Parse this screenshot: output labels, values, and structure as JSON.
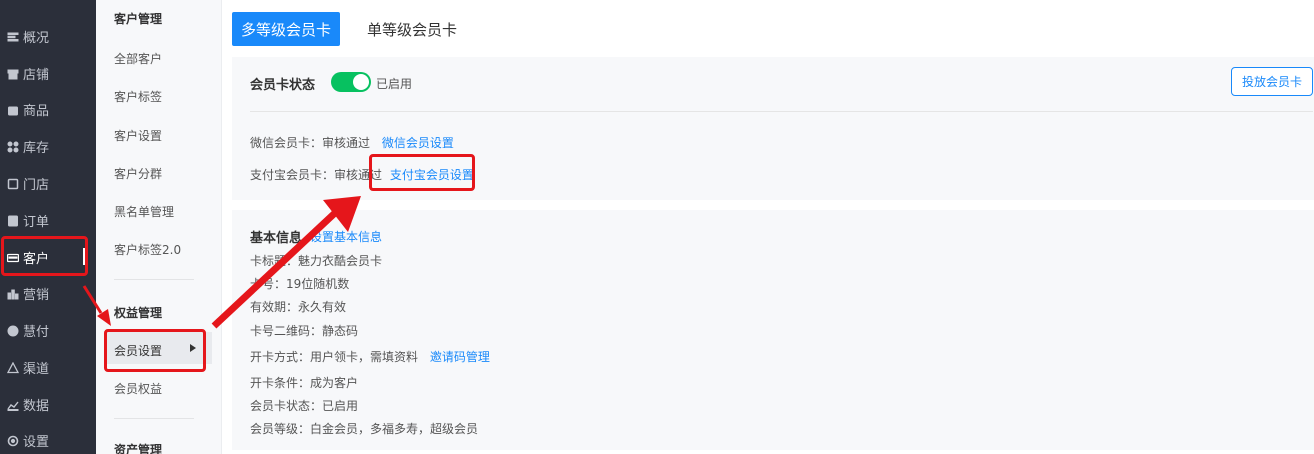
{
  "nav": {
    "items": [
      {
        "label": "概况",
        "icon": "menu-lines-icon"
      },
      {
        "label": "店铺",
        "icon": "shop-icon"
      },
      {
        "label": "商品",
        "icon": "bag-icon"
      },
      {
        "label": "库存",
        "icon": "grid-dots-icon"
      },
      {
        "label": "门店",
        "icon": "store-icon"
      },
      {
        "label": "订单",
        "icon": "document-icon"
      },
      {
        "label": "客户",
        "icon": "card-icon",
        "active": true
      },
      {
        "label": "营销",
        "icon": "bar-chart-icon"
      },
      {
        "label": "慧付",
        "icon": "coin-icon"
      },
      {
        "label": "渠道",
        "icon": "warning-icon"
      },
      {
        "label": "数据",
        "icon": "line-chart-icon"
      },
      {
        "label": "设置",
        "icon": "gear-icon"
      }
    ]
  },
  "submenu": {
    "group1_title": "客户管理",
    "group1_items": [
      "全部客户",
      "客户标签",
      "客户设置",
      "客户分群",
      "黑名单管理",
      "客户标签2.0"
    ],
    "group2_title": "权益管理",
    "group2_items": [
      "会员设置",
      "会员权益"
    ],
    "group3_title": "资产管理"
  },
  "tabs": [
    "多等级会员卡",
    "单等级会员卡"
  ],
  "status": {
    "label": "会员卡状态",
    "switch_text": "已启用",
    "button": "投放会员卡"
  },
  "wechat": {
    "label": "微信会员卡：审核通过",
    "link": "微信会员设置"
  },
  "alipay": {
    "label": "支付宝会员卡：审核通过",
    "link": "支付宝会员设置"
  },
  "basic": {
    "title": "基本信息",
    "edit_link": "设置基本信息",
    "rows": [
      "卡标题：魅力衣酷会员卡",
      "卡号：19位随机数",
      "有效期：永久有效",
      "卡号二维码：静态码",
      "开卡方式：用户领卡，需填资料",
      "开卡条件：成为客户",
      "会员卡状态：已启用",
      "会员等级：白金会员，多福多寿，超级会员"
    ],
    "invite_link": "邀请码管理"
  },
  "colors": {
    "primary": "#1989fa",
    "switch_on": "#07c160",
    "annotation_red": "#e5161b",
    "nav_bg": "#2b2f3a"
  }
}
